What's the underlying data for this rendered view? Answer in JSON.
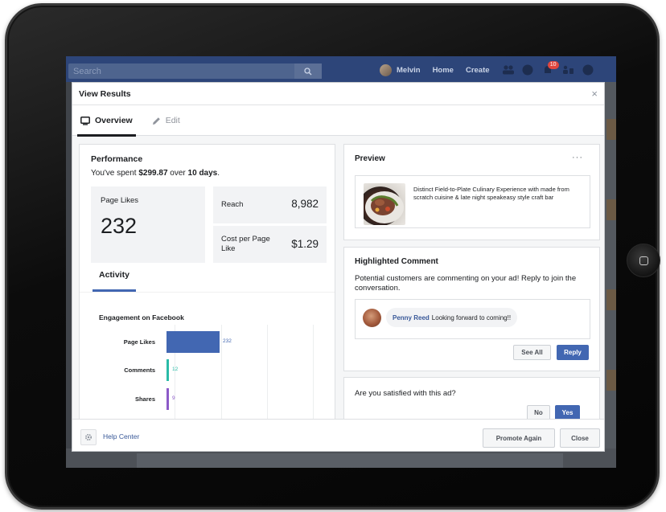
{
  "topbar": {
    "search_placeholder": "Search",
    "user_name": "Melvin",
    "home_label": "Home",
    "create_label": "Create",
    "notification_count": "10"
  },
  "dialog": {
    "title": "View Results",
    "close_glyph": "×",
    "tabs": [
      {
        "label": "Overview",
        "icon": "monitor-icon",
        "active": true
      },
      {
        "label": "Edit",
        "icon": "pencil-icon",
        "active": false
      }
    ]
  },
  "performance": {
    "title": "Performance",
    "spent_prefix": "You've spent ",
    "spent_amount": "$299.87",
    "spent_middle": " over ",
    "spent_days": "10 days",
    "spent_suffix": ".",
    "page_likes_label": "Page Likes",
    "page_likes_value": "232",
    "reach_label": "Reach",
    "reach_value": "8,982",
    "cost_label": "Cost per Page Like",
    "cost_value": "$1.29",
    "activity_tab": "Activity",
    "engagement_title": "Engagement on Facebook"
  },
  "chart_data": {
    "type": "bar",
    "orientation": "horizontal",
    "title": "Engagement on Facebook",
    "categories": [
      "Page Likes",
      "Comments",
      "Shares"
    ],
    "values": [
      232,
      12,
      9
    ],
    "colors": [
      "#4267b2",
      "#2abba7",
      "#8c5ac8"
    ],
    "grid": true
  },
  "preview": {
    "title": "Preview",
    "more_glyph": "···",
    "ad_text": "Distinct Field-to-Plate Culinary Experience with made from scratch cuisine & late night speakeasy style craft bar"
  },
  "highlighted": {
    "title": "Highlighted Comment",
    "text": "Potential customers are commenting on your ad! Reply to join the conversation.",
    "comment_author": "Penny Reed",
    "comment_text": "Looking forward to coming!!",
    "see_all_label": "See All",
    "reply_label": "Reply"
  },
  "satisfaction": {
    "question": "Are you satisfied with this ad?",
    "no_label": "No",
    "yes_label": "Yes"
  },
  "footer": {
    "help_label": "Help Center",
    "promote_label": "Promote Again",
    "close_label": "Close"
  },
  "colors": {
    "brand_blue": "#4267b2",
    "topbar": "#2d4579",
    "link": "#385898"
  }
}
